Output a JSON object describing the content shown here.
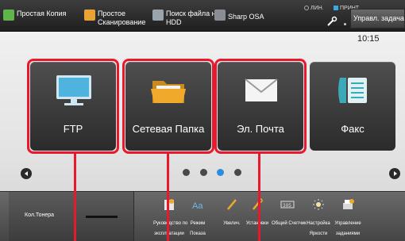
{
  "topbar": {
    "shortcuts": [
      {
        "label": "Простая Копия",
        "icon": "copy-icon"
      },
      {
        "label": "Простое Сканирование",
        "icon": "scan-icon"
      },
      {
        "label": "Поиск файла на HDD",
        "icon": "hdd-search-icon"
      },
      {
        "label": "Sharp OSA",
        "icon": "osa-icon"
      }
    ],
    "status_line": "ЛИН.",
    "status_print": "ПРИНТ",
    "jobs_button": "Управл. задачами"
  },
  "clock": "10:15",
  "tiles": [
    {
      "label": "FTP",
      "icon": "monitor-icon"
    },
    {
      "label": "Сетевая Папка",
      "icon": "folder-icon"
    },
    {
      "label": "Эл. Почта",
      "icon": "envelope-icon"
    },
    {
      "label": "Факс",
      "icon": "fax-icon"
    }
  ],
  "pager": {
    "pages": 4,
    "current": 3
  },
  "bottombar": {
    "toner_label": "Кол.Тонера",
    "functions": [
      {
        "label1": "Руководство по",
        "label2": "эксплуатации"
      },
      {
        "label1": "Режим",
        "label2": "Показа"
      },
      {
        "label1": "Увелич.",
        "label2": ""
      },
      {
        "label1": "Установки",
        "label2": ""
      },
      {
        "label1": "Общий Счетчик",
        "label2": ""
      },
      {
        "label1": "Настройка",
        "label2": "Яркости"
      },
      {
        "label1": "Управление",
        "label2": "заданиями"
      }
    ]
  },
  "colors": {
    "highlight": "#e8192c",
    "active_page": "#2a8de0"
  }
}
